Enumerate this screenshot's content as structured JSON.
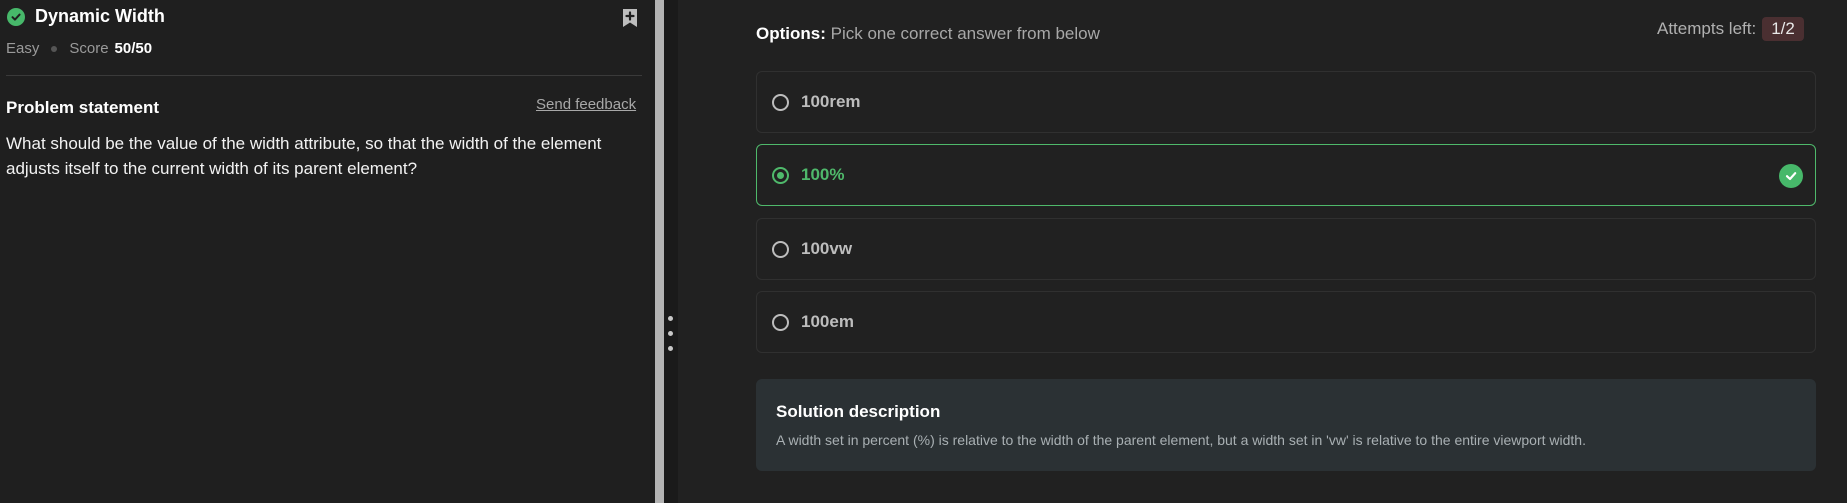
{
  "problem": {
    "title": "Dynamic Width",
    "difficulty": "Easy",
    "score_label": "Score",
    "score_value": "50/50",
    "statement_heading": "Problem statement",
    "feedback_link": "Send feedback",
    "question": "What should be the value of the width attribute, so that the width of the element adjusts itself to the current width of its parent element?"
  },
  "options_header": {
    "label": "Options:",
    "instruction": "Pick one correct answer from below",
    "attempts_label": "Attempts left:",
    "attempts_value": "1/2"
  },
  "options": [
    {
      "label": "100rem",
      "selected": false
    },
    {
      "label": "100%",
      "selected": true,
      "correct": true
    },
    {
      "label": "100vw",
      "selected": false
    },
    {
      "label": "100em",
      "selected": false
    }
  ],
  "solution": {
    "title": "Solution description",
    "text": "A width set in percent (%) is relative to the width of the parent element, but a width set in 'vw' is relative to the entire viewport width."
  },
  "colors": {
    "success": "#47b86a",
    "background": "#1e1e1e",
    "attempts_badge": "#4a2f31",
    "solution_bg": "#2b3134"
  },
  "icons": {
    "solved": "check-circle-icon",
    "bookmark": "bookmark-add-icon",
    "correct": "check-circle-icon",
    "splitter": "drag-handle-icon"
  }
}
